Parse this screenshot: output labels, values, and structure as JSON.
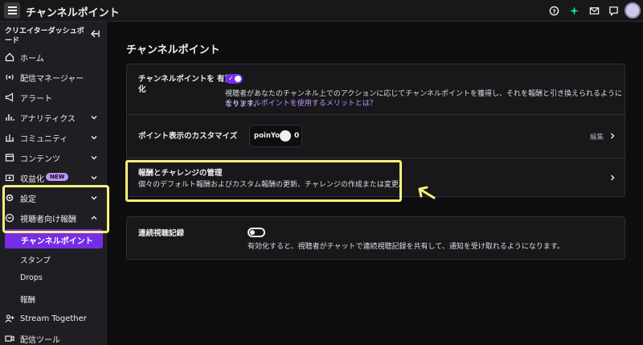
{
  "header": {
    "title": "チャンネルポイント",
    "icons": [
      "help-icon",
      "sparkle-icon",
      "mail-icon",
      "chat-icon",
      "avatar"
    ]
  },
  "sidebar": {
    "heading": "クリエイターダッシュボード",
    "items": [
      {
        "label": "ホーム",
        "icon": "home-icon"
      },
      {
        "label": "配信マネージャー",
        "icon": "broadcast-icon"
      },
      {
        "label": "アラート",
        "icon": "megaphone-icon"
      },
      {
        "label": "アナリティクス",
        "icon": "chart-icon"
      },
      {
        "label": "コミュニティ",
        "icon": "community-icon"
      },
      {
        "label": "コンテンツ",
        "icon": "content-icon"
      },
      {
        "label": "収益化",
        "icon": "money-icon",
        "badge": "NEW"
      },
      {
        "label": "設定",
        "icon": "gear-icon"
      },
      {
        "label": "視聴者向け報酬",
        "icon": "reward-icon"
      }
    ],
    "subitems": [
      "チャンネルポイント",
      "スタンプ",
      "Drops",
      "報酬"
    ],
    "more_items": [
      {
        "label": "Stream Together",
        "icon": "add-user-icon"
      },
      {
        "label": "配信ツール",
        "icon": "camera-icon"
      }
    ]
  },
  "main": {
    "title": "チャンネルポイント",
    "enable": {
      "label": "チャンネルポイントを 有効化",
      "description": "視聴者があなたのチャンネル上でのアクションに応じてチャンネルポイントを獲得し、それを報酬と引き換えられるようになります。",
      "link": "チャンネルポイントを使用するメリットとは？"
    },
    "customize": {
      "label": "ポイント表示のカスタマイズ",
      "points_name": "poinYo",
      "points_value": "0",
      "edit": "編集"
    },
    "manage": {
      "title": "報酬とチャレンジの管理",
      "description": "個々のデフォルト報酬およびカスタム報酬の更新、チャレンジの作成または変更。"
    },
    "streak": {
      "label": "連続視聴記録",
      "description": "有効化すると、視聴者がチャットで連続視聴記録を共有して、通知を受け取れるようになります。"
    }
  },
  "colors": {
    "accent": "#772ce8",
    "link": "#bf94ff",
    "highlight": "#f5f07a"
  }
}
